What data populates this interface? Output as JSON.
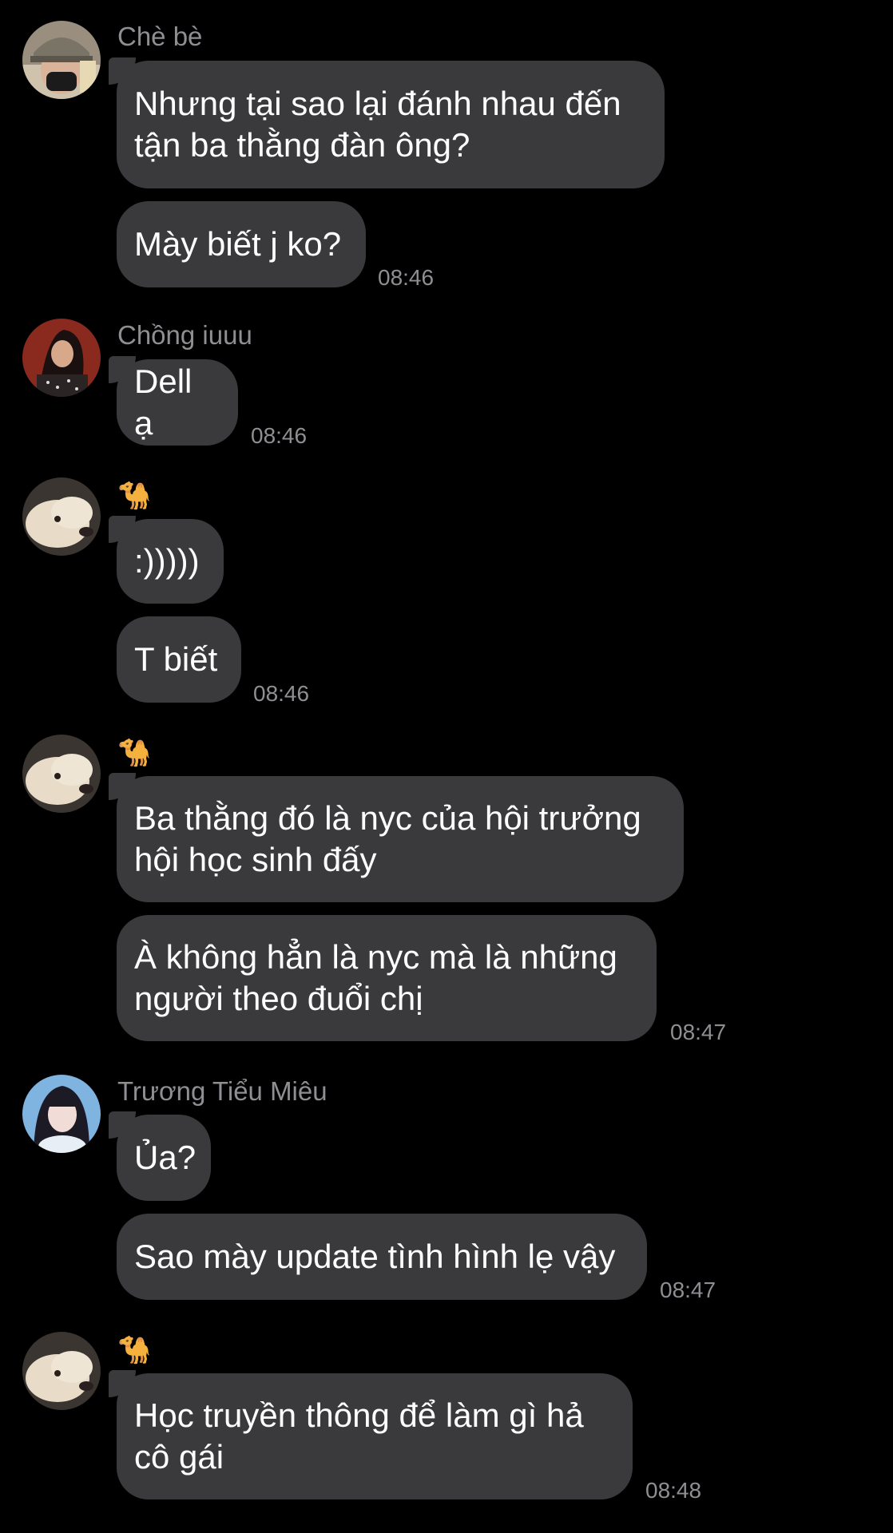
{
  "groups": [
    {
      "sender": "Chè bè",
      "avatar": "woman-with-cap-and-mask-avatar",
      "messages": [
        "Nhưng tại sao lại đánh nhau đến\ntận ba thằng đàn ông?",
        "Mày biết j ko?"
      ],
      "time": "08:46"
    },
    {
      "sender": "Chồng iuuu",
      "avatar": "woman-dark-hair-red-background-avatar",
      "messages": [
        "Dell ạ"
      ],
      "time": "08:46"
    },
    {
      "sender": "🐪",
      "avatar": "golden-retriever-dog-avatar",
      "messages": [
        ":)))))",
        "T biết"
      ],
      "time": "08:46"
    },
    {
      "sender": "🐪",
      "avatar": "golden-retriever-dog-avatar",
      "messages": [
        "Ba thằng đó là nyc của hội trưởng\nhội học sinh đấy",
        "À không hẳn là nyc mà là những\nngười theo đuổi chị"
      ],
      "time": "08:47"
    },
    {
      "sender": "Trương Tiểu Miêu",
      "avatar": "anime-girl-blue-avatar",
      "messages": [
        "Ủa?",
        "Sao mày update tình hình lẹ vậy"
      ],
      "time": "08:47"
    },
    {
      "sender": "🐪",
      "avatar": "golden-retriever-dog-avatar",
      "messages": [
        "Học truyền thông để làm gì hả\ncô gái"
      ],
      "time": "08:48"
    }
  ]
}
